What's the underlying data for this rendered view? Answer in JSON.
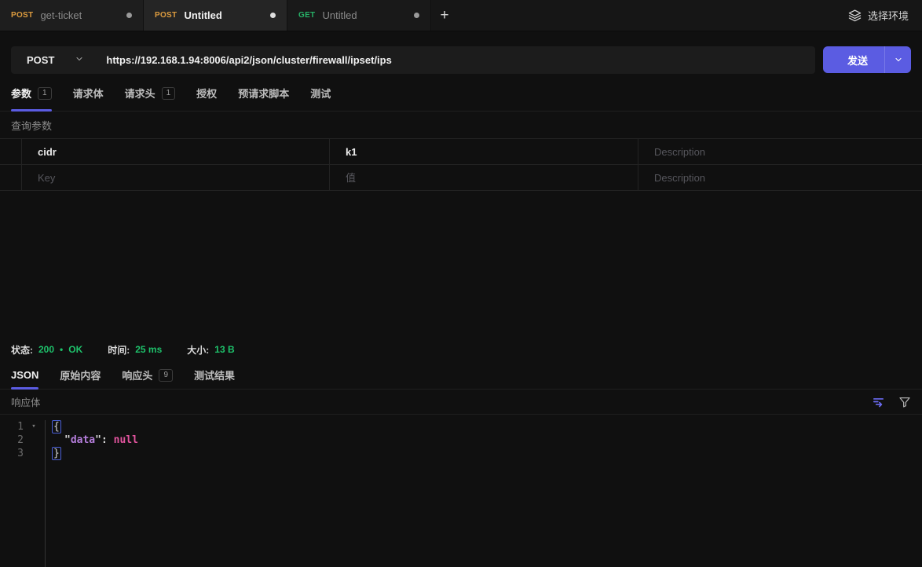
{
  "colors": {
    "accent": "#5b5ce2",
    "method_post": "#dd9c3f",
    "method_get": "#27b368",
    "status_green": "#1ec26b",
    "json_key": "#b57edc",
    "json_null": "#e2549e"
  },
  "tabbar": {
    "tabs": [
      {
        "method": "POST",
        "title": "get-ticket"
      },
      {
        "method": "POST",
        "title": "Untitled"
      },
      {
        "method": "GET",
        "title": "Untitled"
      }
    ],
    "new_tab_label": "+",
    "env_selector_label": "选择环境"
  },
  "request": {
    "method": "POST",
    "url": "https://192.168.1.94:8006/api2/json/cluster/firewall/ipset/ips",
    "send_label": "发送"
  },
  "request_tabs": [
    {
      "label": "参数",
      "badge": "1"
    },
    {
      "label": "请求体"
    },
    {
      "label": "请求头",
      "badge": "1"
    },
    {
      "label": "授权"
    },
    {
      "label": "预请求脚本"
    },
    {
      "label": "测试"
    }
  ],
  "query_params": {
    "section_label": "查询参数",
    "rows": [
      {
        "key": "cidr",
        "value": "k1",
        "description": "",
        "description_placeholder": "Description"
      },
      {
        "key_placeholder": "Key",
        "value_placeholder": "值",
        "description_placeholder": "Description"
      }
    ]
  },
  "response": {
    "status_label": "状态:",
    "status_code": "200",
    "status_bullet": "•",
    "status_text": "OK",
    "time_label": "时间:",
    "time_value": "25 ms",
    "size_label": "大小:",
    "size_value": "13 B",
    "tabs": [
      {
        "label": "JSON"
      },
      {
        "label": "原始内容"
      },
      {
        "label": "响应头",
        "badge": "9"
      },
      {
        "label": "测试结果"
      }
    ],
    "body_label": "响应体"
  },
  "editor": {
    "gutter": [
      "1",
      "2",
      "3"
    ],
    "fold_arrow": "▾",
    "open_brace": "{",
    "close_brace": "}",
    "quote": "\"",
    "key_name": "data",
    "colon": ": ",
    "value": "null"
  }
}
